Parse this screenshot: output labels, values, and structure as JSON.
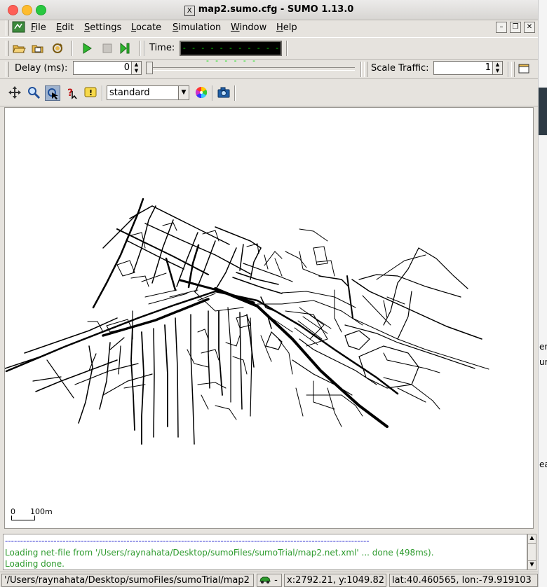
{
  "window": {
    "title": "map2.sumo.cfg - SUMO 1.13.0"
  },
  "menu": {
    "items": [
      "File",
      "Edit",
      "Settings",
      "Locate",
      "Simulation",
      "Window",
      "Help"
    ]
  },
  "toolbar": {
    "time_label": "Time:",
    "time_display": "- - - - - - - - - - - - - - - - -"
  },
  "controls": {
    "delay_label": "Delay (ms):",
    "delay_value": "0",
    "scale_label": "Scale Traffic:",
    "scale_value": "1"
  },
  "view": {
    "scheme": "standard",
    "scale_zero": "0",
    "scale_distance": "100m"
  },
  "messages": {
    "separator": "------------------------------------------------------------------------------------------------------------------------",
    "line1": "Loading net-file from '/Users/raynahata/Desktop/sumoFiles/sumoTrial/map2.net.xml' ... done (498ms).",
    "line2": "Loading done.",
    "color": "#2e9b2e",
    "sep_color": "#2a2ad0"
  },
  "statusbar": {
    "path": "'/Users/raynahata/Desktop/sumoFiles/sumoTrial/map2",
    "car_menu": "-",
    "xy": "x:2792.21, y:1049.82",
    "latlon": "lat:40.460565, lon:-79.919103"
  },
  "behind_window_text": {
    "a": "en",
    "b": "um",
    "c": "ea"
  }
}
